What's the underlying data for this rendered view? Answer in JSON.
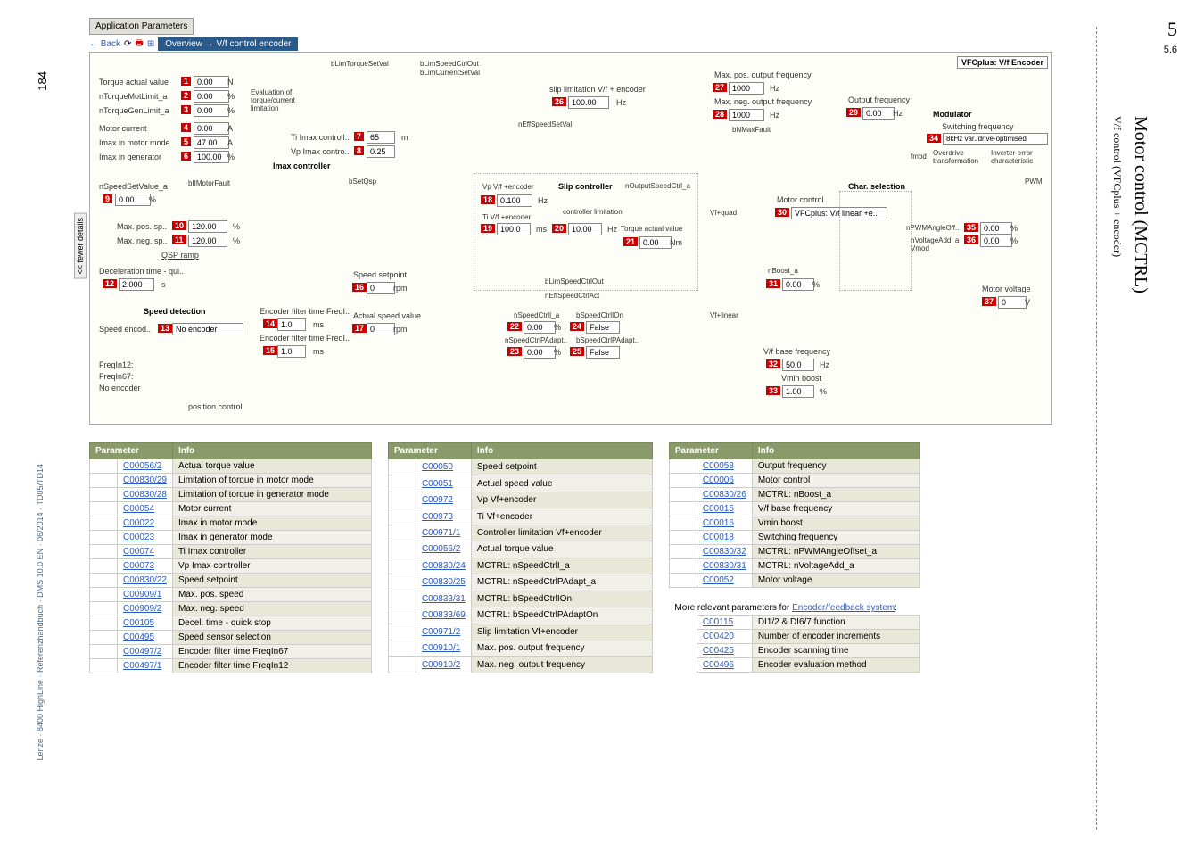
{
  "page": {
    "number": "184",
    "footer": "Lenze · 8400 HighLine · Referenzhandbuch · DMS 10.0 EN · 06/2014 · TD05/TD14",
    "chapter": "5",
    "section": "5.6",
    "title_main": "Motor control (MCTRL)",
    "title_sub": "V/f control (VFCplus + encoder)"
  },
  "app": {
    "tab": "Application Parameters",
    "back": "← Back",
    "crumb": "Overview → V/f control encoder",
    "fewer": "<< fewer details"
  },
  "diag": {
    "torque_actual": "Torque actual value",
    "v1": "0.00",
    "u1": "N",
    "ntorquemot": "nTorqueMotLimit_a",
    "v2": "0.00",
    "u2": "%",
    "ntorquegen": "nTorqueGenLimit_a",
    "v3": "0.00",
    "u3": "%",
    "eval": "Evaluation of\ntorque/current\nlimitation",
    "motor_current": "Motor current",
    "v4": "0.00",
    "u4": "A",
    "imax_motor": "Imax in motor mode",
    "v5": "47.00",
    "u5": "A",
    "imax_gen": "Imax in generator",
    "v6": "100.00",
    "u6": "%",
    "ti_imax": "Ti Imax controll..",
    "v7": "65",
    "u7": "m",
    "vp_imax": "Vp Imax contro..",
    "v8": "0.25",
    "imax_ctrl": "Imax controller",
    "nspeedset": "nSpeedSetValue_a",
    "v9": "0.00",
    "u9": "%",
    "max_pos_sp": "Max. pos. sp..",
    "v10": "120.00",
    "u10": "%",
    "max_neg_sp": "Max. neg. sp..",
    "v11": "120.00",
    "u11": "%",
    "qsp": "QSP ramp",
    "decel": "Deceleration time - qui..",
    "v12": "2.000",
    "u12": "s",
    "speed_det": "Speed detection",
    "speed_encod": "Speed encod..",
    "v13": "No encoder",
    "enc_filter67": "Encoder filter time FreqI..",
    "v14": "1.0",
    "u14": "ms",
    "enc_filter12": "Encoder filter time FreqI..",
    "v15": "1.0",
    "u15": "ms",
    "speed_setpoint": "Speed setpoint",
    "v16": "0",
    "u16": "rpm",
    "actual_speed": "Actual speed value",
    "v17": "0",
    "u17": "rpm",
    "freqin12": "FreqIn12:",
    "freqin67": "FreqIn67:",
    "no_enc": "No encoder",
    "pos_ctrl": "position control",
    "blim_torque": "bLimTorqueSetVal",
    "blim_speed": "bLimSpeedCtrlOut",
    "blim_current": "bLimCurrentSetVal",
    "slip_lim": "slip limitation V/f + encoder",
    "v26": "100.00",
    "u26": "Hz",
    "neff": "nEffSpeedSetVal",
    "slip_ctrl": "Slip controller",
    "noutput": "nOutputSpeedCtrl_a",
    "vp_vf": "Vp V/f +encoder",
    "v18": "0.100",
    "u18": "Hz",
    "ctrl_lim": "controller limitation",
    "ti_vf": "Ti V/f +encoder",
    "v19": "100.0",
    "u19": "ms",
    "v20": "10.00",
    "u20": "Hz",
    "torque_av": "Torque actual value",
    "v21": "0.00",
    "u21": "Nm",
    "blim_sco": "bLimSpeedCtrlOut",
    "neff_act": "nEffSpeedCtrlAct",
    "nspeedctrl": "nSpeedCtrlI_a",
    "v22": "0.00",
    "u22": "%",
    "bspeedon": "bSpeedCtrlIOn",
    "v24": "False",
    "nspeedpa": "nSpeedCtrlPAdapt..",
    "v23": "0.00",
    "u23": "%",
    "bspeedpa": "bSpeedCtrlPAdapt..",
    "v25": "False",
    "max_pos_of": "Max. pos. output frequency",
    "v27": "1000",
    "u27": "Hz",
    "max_neg_of": "Max. neg. output frequency",
    "v28": "1000",
    "u28": "Hz",
    "bnmax": "bNMaxFault",
    "motor_ctrl": "Motor control",
    "v30": "VFCplus: V/f linear +e..",
    "vf_quad": "Vf+quad",
    "nboost": "nBoost_a",
    "v31": "0.00",
    "u31": "%",
    "vf_linear": "Vf+linear",
    "vf_base": "V/f base frequency",
    "v32": "50.0",
    "u32": "Hz",
    "vmin": "Vmin boost",
    "v33": "1.00",
    "u33": "%",
    "out_freq": "Output frequency",
    "v29": "0.00",
    "u29": "Hz",
    "modulator": "Modulator",
    "sw_freq": "Switching frequency",
    "v34": "8kHz var./drive-optimised",
    "overdrive": "Overdrive\ntransformation",
    "inv_err": "Inverter-error\ncharacteristic",
    "fmod": "fmod",
    "vmod": "Vmod",
    "pwm": "PWM",
    "char_sel": "Char. selection",
    "npwm": "nPWMAngleOff..",
    "v35": "0.00",
    "u35": "%",
    "nvolt": "nVoltageAdd_a",
    "v36": "0.00",
    "u36": "%",
    "motor_v": "Motor voltage",
    "v37": "0",
    "u37": "V",
    "vfcplus_hdr": "VFCplus: V/f Encoder",
    "bsetqsp": "bSetQsp",
    "bmotorfault": "bIIMotorFault"
  },
  "t1": {
    "h_param": "Parameter",
    "h_info": "Info",
    "rows": [
      {
        "n": "1",
        "p": "C00056/2",
        "i": "Actual torque value"
      },
      {
        "n": "2",
        "p": "C00830/29",
        "i": "Limitation of torque in motor mode"
      },
      {
        "n": "3",
        "p": "C00830/28",
        "i": "Limitation of torque in generator mode"
      },
      {
        "n": "4",
        "p": "C00054",
        "i": "Motor current"
      },
      {
        "n": "5",
        "p": "C00022",
        "i": "Imax in motor mode"
      },
      {
        "n": "6",
        "p": "C00023",
        "i": "Imax in generator mode"
      },
      {
        "n": "7",
        "p": "C00074",
        "i": "Ti Imax controller"
      },
      {
        "n": "8",
        "p": "C00073",
        "i": "Vp Imax controller"
      },
      {
        "n": "9",
        "p": "C00830/22",
        "i": "Speed setpoint"
      },
      {
        "n": "10",
        "p": "C00909/1",
        "i": "Max. pos. speed"
      },
      {
        "n": "11",
        "p": "C00909/2",
        "i": "Max. neg. speed"
      },
      {
        "n": "12",
        "p": "C00105",
        "i": "Decel. time - quick stop"
      },
      {
        "n": "13",
        "p": "C00495",
        "i": "Speed sensor selection"
      },
      {
        "n": "14",
        "p": "C00497/2",
        "i": "Encoder filter time FreqIn67"
      },
      {
        "n": "15",
        "p": "C00497/1",
        "i": "Encoder filter time FreqIn12"
      }
    ]
  },
  "t2": {
    "rows": [
      {
        "n": "16",
        "p": "C00050",
        "i": "Speed setpoint"
      },
      {
        "n": "17",
        "p": "C00051",
        "i": "Actual speed value"
      },
      {
        "n": "18",
        "p": "C00972",
        "i": "Vp Vf+encoder"
      },
      {
        "n": "19",
        "p": "C00973",
        "i": "Ti Vf+encoder"
      },
      {
        "n": "20",
        "p": "C00971/1",
        "i": "Controller limitation Vf+encoder"
      },
      {
        "n": "21",
        "p": "C00056/2",
        "i": "Actual torque value"
      },
      {
        "n": "22",
        "p": "C00830/24",
        "i": "MCTRL: nSpeedCtrlI_a"
      },
      {
        "n": "23",
        "p": "C00830/25",
        "i": "MCTRL: nSpeedCtrlPAdapt_a"
      },
      {
        "n": "24",
        "p": "C00833/31",
        "i": "MCTRL: bSpeedCtrlIOn"
      },
      {
        "n": "25",
        "p": "C00833/69",
        "i": "MCTRL: bSpeedCtrlPAdaptOn"
      },
      {
        "n": "26",
        "p": "C00971/2",
        "i": "Slip limitation Vf+encoder"
      },
      {
        "n": "27",
        "p": "C00910/1",
        "i": "Max. pos. output frequency"
      },
      {
        "n": "28",
        "p": "C00910/2",
        "i": "Max. neg. output frequency"
      }
    ]
  },
  "t3": {
    "rows": [
      {
        "n": "29",
        "p": "C00058",
        "i": "Output frequency"
      },
      {
        "n": "30",
        "p": "C00006",
        "i": "Motor control"
      },
      {
        "n": "31",
        "p": "C00830/26",
        "i": "MCTRL: nBoost_a"
      },
      {
        "n": "32",
        "p": "C00015",
        "i": "V/f base frequency"
      },
      {
        "n": "33",
        "p": "C00016",
        "i": "Vmin boost"
      },
      {
        "n": "34",
        "p": "C00018",
        "i": "Switching frequency"
      },
      {
        "n": "35",
        "p": "C00830/32",
        "i": "MCTRL: nPWMAngleOffset_a"
      },
      {
        "n": "36",
        "p": "C00830/31",
        "i": "MCTRL: nVoltageAdd_a"
      },
      {
        "n": "37",
        "p": "C00052",
        "i": "Motor voltage"
      }
    ],
    "more_text": "More relevant parameters for ",
    "more_link": "Encoder/feedback system",
    "extra": [
      {
        "p": "C00115",
        "i": "DI1/2 & DI6/7 function"
      },
      {
        "p": "C00420",
        "i": "Number of encoder increments"
      },
      {
        "p": "C00425",
        "i": "Encoder scanning time"
      },
      {
        "p": "C00496",
        "i": "Encoder evaluation method"
      }
    ]
  }
}
